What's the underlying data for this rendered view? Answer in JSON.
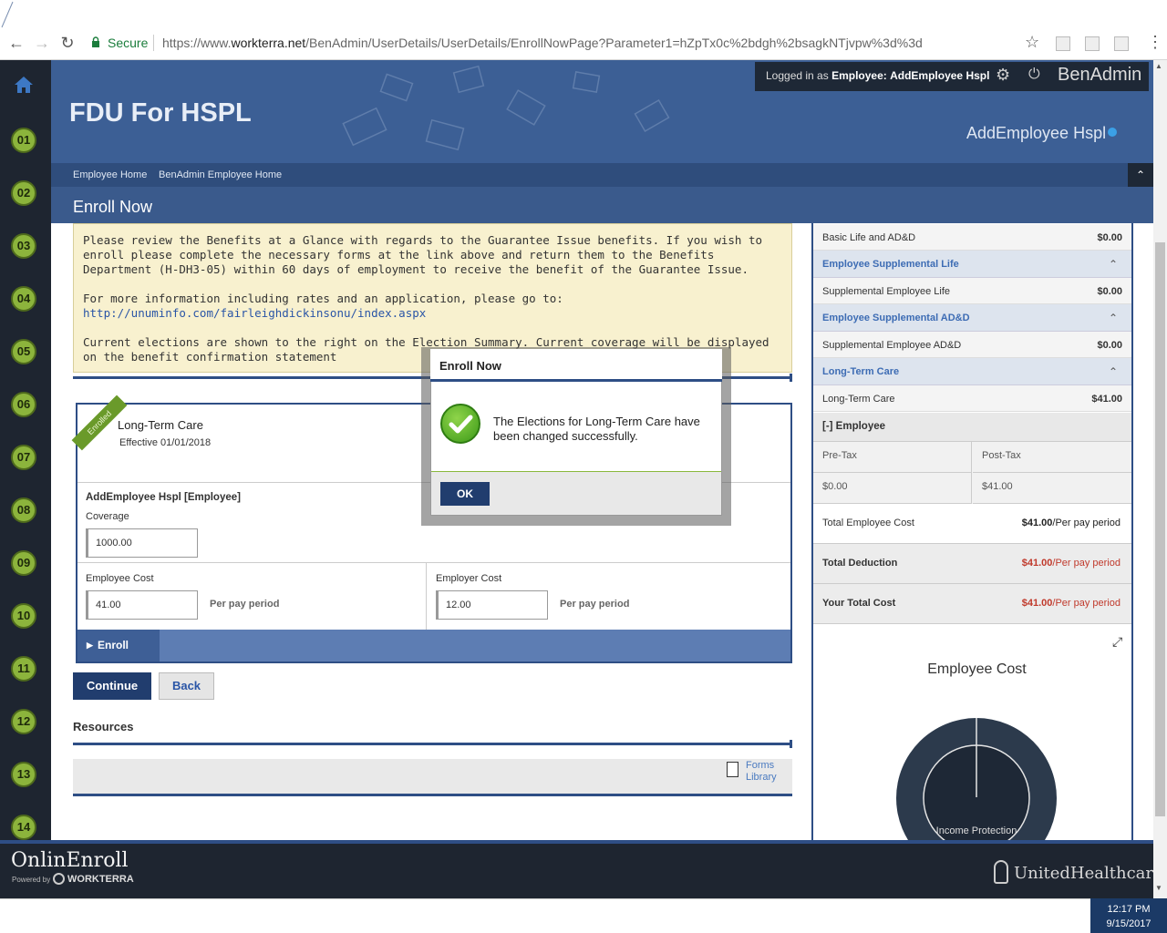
{
  "browser": {
    "secure_label": "Secure",
    "url_prefix": "https://www.",
    "url_host": "workterra.net",
    "url_path": "/BenAdmin/UserDetails/UserDetails/EnrollNowPage?Parameter1=hZpTx0c%2bdgh%2bsagkNTjvpw%3d%3d"
  },
  "header": {
    "org_title": "FDU For HSPL",
    "logged_prefix": "Logged in as ",
    "logged_role": "Employee:",
    "logged_user": "AddEmployee Hspl",
    "brand": "BenAdmin",
    "employee_name": "AddEmployee Hspl"
  },
  "breadcrumbs": [
    "Employee Home",
    "BenAdmin Employee Home"
  ],
  "page_title": "Enroll Now",
  "steps": [
    "01",
    "02",
    "03",
    "04",
    "05",
    "06",
    "07",
    "08",
    "09",
    "10",
    "11",
    "12",
    "13",
    "14"
  ],
  "notice": {
    "para1": "Please review the Benefits at a Glance with regards to the Guarantee Issue benefits. If you wish to enroll please complete the necessary forms at the link above and return them to the Benefits Department (H-DH3-05) within 60 days of employment to receive the benefit of the Guarantee Issue.",
    "para2": "For more information including rates and an application, please go to:",
    "link": "http://unuminfo.com/fairleighdickinsonu/index.aspx",
    "para3": "Current elections are shown to the right on the Election Summary. Current coverage will be displayed on the benefit confirmation statement"
  },
  "plan": {
    "ribbon": "Enrolled",
    "name": "Long-Term Care",
    "effective": "Effective 01/01/2018",
    "member": "AddEmployee Hspl [Employee]",
    "coverage_label": "Coverage",
    "coverage_value": "1000.00",
    "employee_cost_label": "Employee Cost",
    "employee_cost_value": "41.00",
    "employer_cost_label": "Employer Cost",
    "employer_cost_value": "12.00",
    "per_pay_period": "Per pay period",
    "enroll_tab": "Enroll"
  },
  "buttons": {
    "continue": "Continue",
    "back": "Back"
  },
  "resources": {
    "title": "Resources",
    "forms_line1": "Forms",
    "forms_line2": "Library"
  },
  "summary": {
    "basic_life_label": "Basic Life and AD&D",
    "basic_life_value": "$0.00",
    "sec_supp_life": "Employee Supplemental Life",
    "supp_life_label": "Supplemental Employee Life",
    "supp_life_value": "$0.00",
    "sec_supp_add": "Employee Supplemental AD&D",
    "supp_add_label": "Supplemental Employee AD&D",
    "supp_add_value": "$0.00",
    "sec_ltc": "Long-Term Care",
    "ltc_label": "Long-Term Care",
    "ltc_value": "$41.00",
    "employee_toggle": "[-] Employee",
    "pretax_label": "Pre-Tax",
    "posttax_label": "Post-Tax",
    "pretax_value": "$0.00",
    "posttax_value": "$41.00",
    "total_emp_cost_label": "Total Employee Cost",
    "total_emp_cost_value": "$41.00",
    "total_deduction_label": "Total Deduction",
    "total_deduction_value": "$41.00",
    "your_total_label": "Your Total Cost",
    "your_total_value": "$41.00",
    "per_pay_suffix": "/Per pay period",
    "chart_title": "Employee Cost",
    "chart_label": "Income Protection"
  },
  "footer": {
    "ole_logo": "OnlinEnroll",
    "powered_by": "Powered by",
    "workterra": "WORKTERRA",
    "uhc": "UnitedHealthcare"
  },
  "taskbar": {
    "time": "12:17 PM",
    "date": "9/15/2017"
  },
  "modal": {
    "title": "Enroll Now",
    "message": "The Elections for Long-Term Care have been changed successfully.",
    "ok": "OK"
  },
  "colors": {
    "accent": "#3c5f95",
    "nav_dark": "#1e2530",
    "step_green": "#8cb43c",
    "cost_red": "#c0392b"
  }
}
